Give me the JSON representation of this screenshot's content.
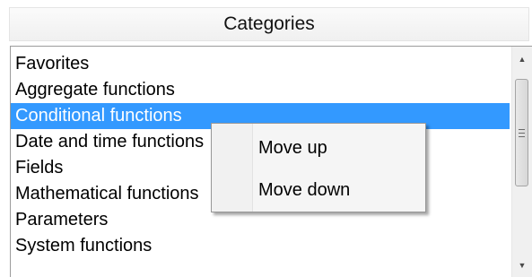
{
  "header": {
    "title": "Categories"
  },
  "categories": {
    "items": [
      {
        "label": "Favorites",
        "selected": false
      },
      {
        "label": "Aggregate functions",
        "selected": false
      },
      {
        "label": "Conditional functions",
        "selected": true
      },
      {
        "label": "Date and time functions",
        "selected": false
      },
      {
        "label": "Fields",
        "selected": false
      },
      {
        "label": "Mathematical functions",
        "selected": false
      },
      {
        "label": "Parameters",
        "selected": false
      },
      {
        "label": "System functions",
        "selected": false
      }
    ]
  },
  "scrollbar": {
    "up_icon": "up-arrow",
    "down_icon": "down-arrow",
    "thumb_icon": "grip-lines"
  },
  "context_menu": {
    "items": [
      {
        "label": "Move up"
      },
      {
        "label": "Move down"
      }
    ]
  },
  "colors": {
    "selection": "#3399ff",
    "selection_text": "#ffffff",
    "menu_bg": "#f5f5f5"
  }
}
